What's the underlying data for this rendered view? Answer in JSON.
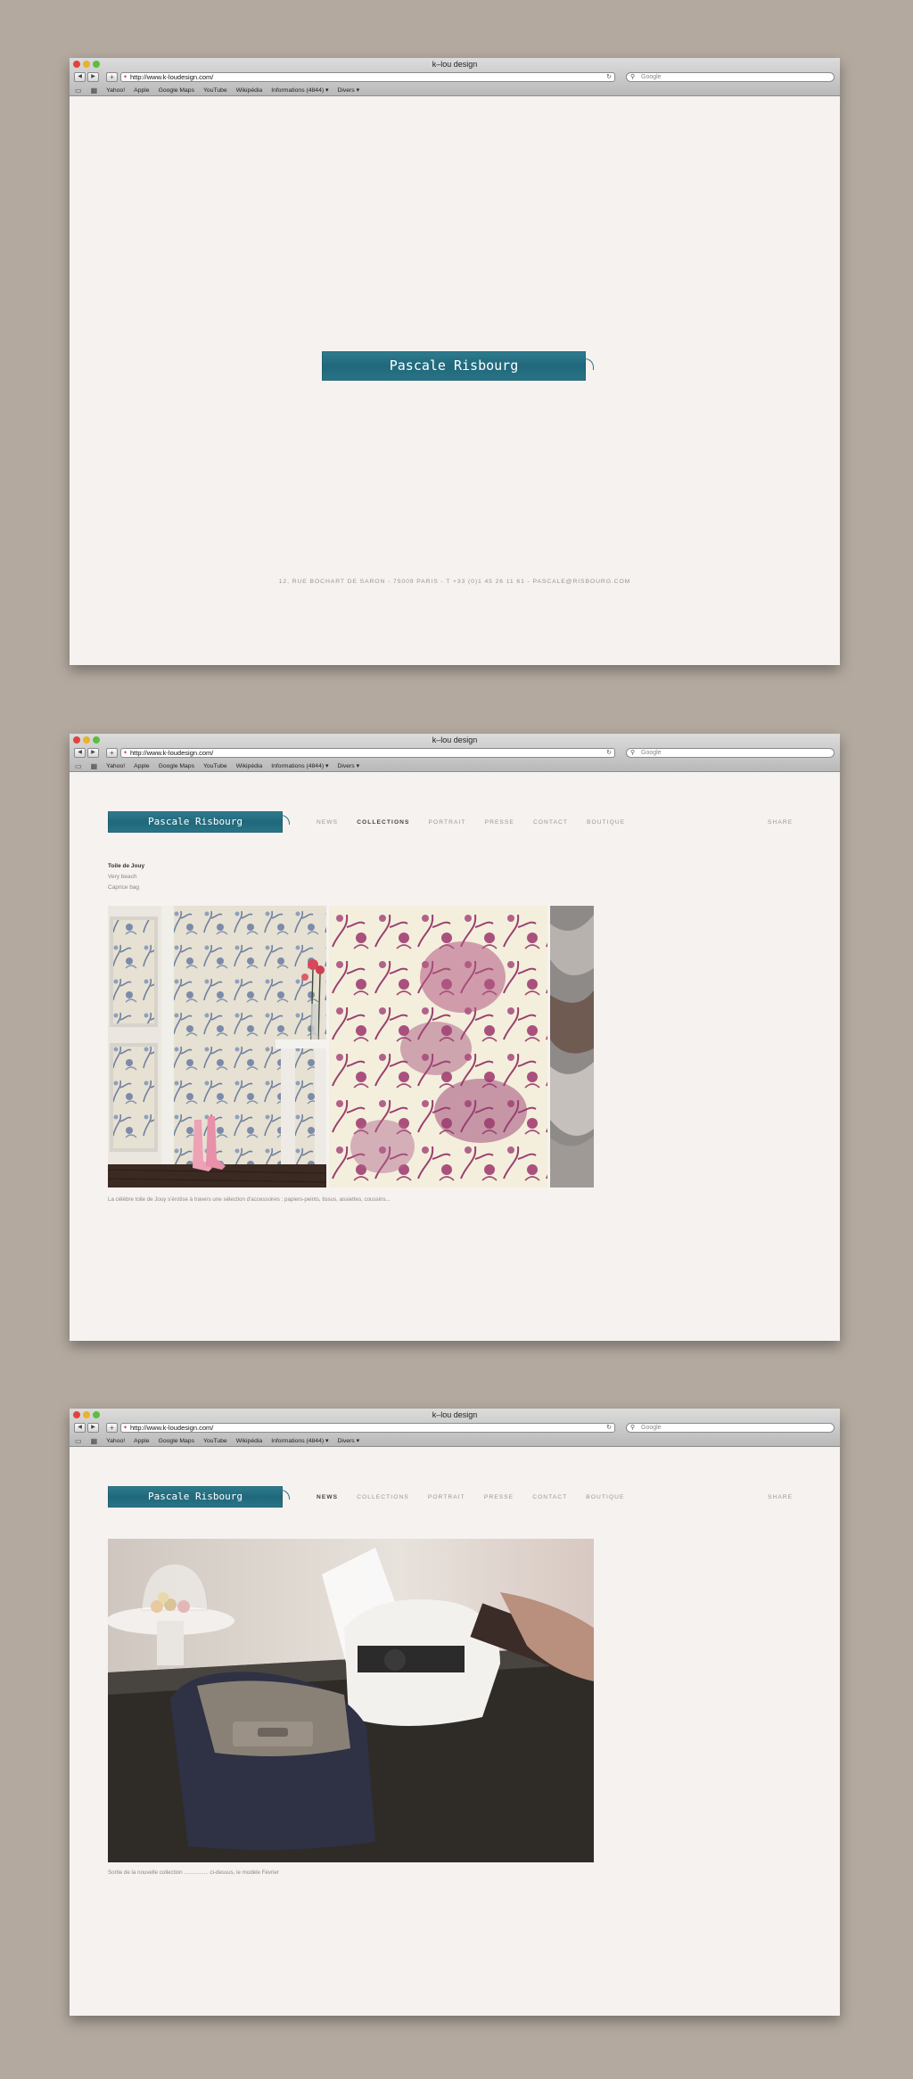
{
  "browser": {
    "title": "k–lou design",
    "url": "http://www.k-loudesign.com/",
    "search_placeholder": "Google",
    "bookmarks": [
      "Yahoo!",
      "Apple",
      "Google Maps",
      "YouTube",
      "Wikipédia",
      "Informations (4844) ▾",
      "Divers ▾"
    ]
  },
  "brand": {
    "name": "Pascale Risbourg",
    "ribbon_color": "#20687b"
  },
  "splash": {
    "address": "12, RUE BOCHART DE SARON - 75009 PARIS - T +33 (0)1 45 26 11 61 - PASCALE@RISBOURG.COM"
  },
  "nav": {
    "items": [
      "NEWS",
      "COLLECTIONS",
      "PORTRAIT",
      "PRESSE",
      "CONTACT",
      "BOUTIQUE"
    ],
    "share": "SHARE"
  },
  "collections": {
    "active_nav": "COLLECTIONS",
    "subnav": [
      "Toile de Jouy",
      "Very beach",
      "Caprice bag"
    ],
    "active_subnav": "Toile de Jouy",
    "caption": "La célèbre toile de Jouy s'érotise à travers une sélection d'accessoires : papiers-peints, tissus, assiettes, coussins..."
  },
  "news": {
    "active_nav": "NEWS",
    "caption": "Sortie de la nouvelle collection ................ ci-dessus, le modèle Février"
  }
}
